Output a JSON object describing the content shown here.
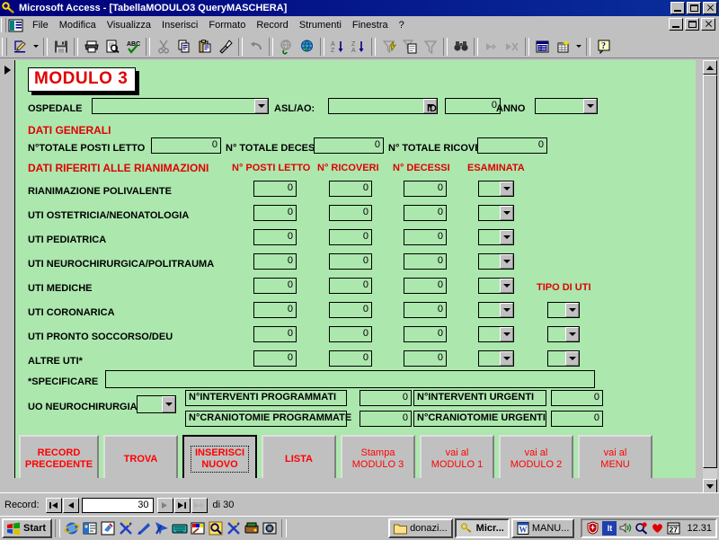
{
  "window": {
    "title": "Microsoft Access - [TabellaMODULO3 QueryMASCHERA]",
    "app_icon": "key-icon",
    "buttons": {
      "minimize": "minimize-icon",
      "restore": "restore-icon",
      "close": "close-icon"
    }
  },
  "menubar": {
    "items": [
      {
        "label": "File"
      },
      {
        "label": "Modifica"
      },
      {
        "label": "Visualizza"
      },
      {
        "label": "Inserisci"
      },
      {
        "label": "Formato"
      },
      {
        "label": "Record"
      },
      {
        "label": "Strumenti"
      },
      {
        "label": "Finestra"
      },
      {
        "label": "?"
      }
    ]
  },
  "toolbar": {
    "buttons": [
      {
        "name": "view-design-icon",
        "glyph": "◤"
      },
      {
        "name": "save-icon",
        "glyph": "ὋE"
      },
      {
        "name": "print-icon",
        "glyph": "print"
      },
      {
        "name": "print-preview-icon",
        "glyph": "preview"
      },
      {
        "name": "spelling-icon",
        "glyph": "ABC"
      },
      {
        "name": "cut-icon",
        "glyph": "✂"
      },
      {
        "name": "copy-icon",
        "glyph": "copy"
      },
      {
        "name": "paste-icon",
        "glyph": "paste"
      },
      {
        "name": "format-painter-icon",
        "glyph": "brush"
      },
      {
        "name": "undo-icon",
        "glyph": "↶"
      },
      {
        "name": "insert-hyperlink-icon",
        "glyph": "link"
      },
      {
        "name": "web-toolbar-icon",
        "glyph": "globe"
      },
      {
        "name": "sort-ascending-icon",
        "glyph": "AZ"
      },
      {
        "name": "sort-descending-icon",
        "glyph": "ZA"
      },
      {
        "name": "filter-by-selection-icon",
        "glyph": "filtersel"
      },
      {
        "name": "filter-by-form-icon",
        "glyph": "filterform"
      },
      {
        "name": "apply-filter-icon",
        "glyph": "funnel"
      },
      {
        "name": "find-icon",
        "glyph": "binoculars"
      },
      {
        "name": "new-record-icon",
        "glyph": "newrec"
      },
      {
        "name": "delete-record-icon",
        "glyph": "delrec"
      },
      {
        "name": "database-window-icon",
        "glyph": "dbwin"
      },
      {
        "name": "new-object-icon",
        "glyph": "newobj"
      },
      {
        "name": "help-icon",
        "glyph": "?"
      }
    ]
  },
  "form": {
    "title": "MODULO 3",
    "fields": {
      "ospedale_label": "OSPEDALE",
      "ospedale_value": "",
      "asl_label": "ASL/AO:",
      "asl_value": "",
      "id_label": "ID",
      "id_value": "0",
      "anno_label": "ANNO",
      "anno_value": ""
    },
    "section_general": {
      "heading": "DATI GENERALI",
      "items": [
        {
          "label": "N°TOTALE POSTI  LETTO",
          "value": "0"
        },
        {
          "label": "N° TOTALE DECESSI",
          "value": "0"
        },
        {
          "label": "N° TOTALE RICOVERI",
          "value": "0"
        }
      ]
    },
    "section_rianimazioni": {
      "heading": "DATI RIFERITI ALLE RIANIMAZIONI",
      "columns": [
        "N° POSTI LETTO",
        "N° RICOVERI",
        "N° DECESSI",
        "ESAMINATA"
      ],
      "tipo_header": "TIPO DI UTI",
      "rows": [
        {
          "label": "RIANIMAZIONE POLIVALENTE",
          "posti": "0",
          "ricoveri": "0",
          "decessi": "0",
          "esaminata": "",
          "tipo": null
        },
        {
          "label": "UTI OSTETRICIA/NEONATOLOGIA",
          "posti": "0",
          "ricoveri": "0",
          "decessi": "0",
          "esaminata": "",
          "tipo": null
        },
        {
          "label": "UTI PEDIATRICA",
          "posti": "0",
          "ricoveri": "0",
          "decessi": "0",
          "esaminata": "",
          "tipo": null
        },
        {
          "label": "UTI NEUROCHIRURGICA/POLITRAUMA",
          "posti": "0",
          "ricoveri": "0",
          "decessi": "0",
          "esaminata": "",
          "tipo": null
        },
        {
          "label": "UTI MEDICHE",
          "posti": "0",
          "ricoveri": "0",
          "decessi": "0",
          "esaminata": "",
          "tipo": null
        },
        {
          "label": "UTI CORONARICA",
          "posti": "0",
          "ricoveri": "0",
          "decessi": "0",
          "esaminata": "",
          "tipo": ""
        },
        {
          "label": "UTI PRONTO SOCCORSO/DEU",
          "posti": "0",
          "ricoveri": "0",
          "decessi": "0",
          "esaminata": "",
          "tipo": ""
        },
        {
          "label": "ALTRE UTI*",
          "posti": "0",
          "ricoveri": "0",
          "decessi": "0",
          "esaminata": "",
          "tipo": ""
        }
      ]
    },
    "specificare": {
      "label": "*SPECIFICARE",
      "value": ""
    },
    "neurochirurgia": {
      "label": "UO NEUROCHIRURGIA",
      "value": "",
      "grid": [
        {
          "left_label": "N°INTERVENTI PROGRAMMATI",
          "left_value": "0",
          "right_label": "N°INTERVENTI URGENTI",
          "right_value": "0"
        },
        {
          "left_label": "N°CRANIOTOMIE PROGRAMMATE",
          "left_value": "0",
          "right_label": "N°CRANIOTOMIE URGENTI",
          "right_value": "0"
        }
      ]
    },
    "buttons": [
      {
        "name": "record-precedente-button",
        "lines": [
          "RECORD",
          "PRECEDENTE"
        ],
        "bold": true,
        "focused": false
      },
      {
        "name": "trova-button",
        "lines": [
          "TROVA"
        ],
        "bold": true,
        "focused": false
      },
      {
        "name": "inserisci-nuovo-button",
        "lines": [
          "INSERISCI",
          "NUOVO"
        ],
        "bold": true,
        "focused": true
      },
      {
        "name": "lista-button",
        "lines": [
          "LISTA"
        ],
        "bold": true,
        "focused": false
      },
      {
        "name": "stampa-modulo-3-button",
        "lines": [
          "Stampa",
          "MODULO 3"
        ],
        "bold": false,
        "focused": false
      },
      {
        "name": "vai-al-modulo-1-button",
        "lines": [
          "vai al",
          "MODULO 1"
        ],
        "bold": false,
        "focused": false
      },
      {
        "name": "vai-al-modulo-2-button",
        "lines": [
          "vai al",
          "MODULO 2"
        ],
        "bold": false,
        "focused": false
      },
      {
        "name": "vai-al-menu-button",
        "lines": [
          "vai al",
          "MENU"
        ],
        "bold": false,
        "focused": false
      }
    ]
  },
  "navbar": {
    "label": "Record:",
    "current": "30",
    "total_prefix": "di",
    "total": "30",
    "buttons": [
      "first-record-icon",
      "previous-record-icon",
      "next-record-icon",
      "last-record-icon",
      "new-record-icon"
    ]
  },
  "taskbar": {
    "start_label": "Start",
    "quicklaunch": [
      "internet-explorer-icon",
      "outlook-express-icon",
      "show-desktop-icon",
      "shortcut-icon",
      "pinned-icon",
      "pointer-icon",
      "keyboard-icon",
      "paint-icon",
      "search-icon",
      "shortcut2-icon",
      "scanner-icon",
      "camera-icon"
    ],
    "items": [
      {
        "name": "taskbar-item-donazi",
        "icon": "folder-icon",
        "label": "donazi...",
        "active": false
      },
      {
        "name": "taskbar-item-access",
        "icon": "key-icon",
        "label": "Micr...",
        "active": true
      },
      {
        "name": "taskbar-item-word",
        "icon": "word-icon",
        "label": "MANU...",
        "active": false
      }
    ],
    "tray": {
      "icons": [
        "antivirus-icon",
        "keyboard-layout-it",
        "volume-icon",
        "scanner-monitor-icon",
        "heart-icon",
        "calendar-27-icon"
      ],
      "keyboard_label": "It",
      "calendar_label": "27",
      "clock": "12.31"
    }
  },
  "colors": {
    "form_background": "#ace7ae",
    "accent_red": "#e00000",
    "button_text_red": "#ff0000",
    "titlebar_blue": "#00007b",
    "window_gray": "#c0c0c0"
  }
}
